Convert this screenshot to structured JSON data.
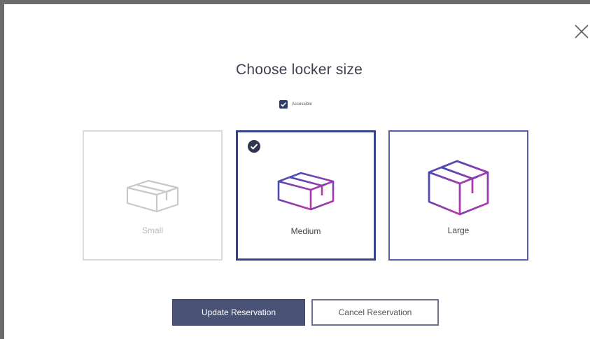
{
  "dialog": {
    "title": "Choose locker size",
    "close_icon": "close-icon"
  },
  "accessible": {
    "label": "Accessible",
    "checked": true
  },
  "sizes": [
    {
      "label": "Small",
      "state": "disabled"
    },
    {
      "label": "Medium",
      "state": "selected"
    },
    {
      "label": "Large",
      "state": "available"
    }
  ],
  "actions": {
    "update_label": "Update Reservation",
    "cancel_label": "Cancel Reservation"
  },
  "colors": {
    "primary": "#4a5275",
    "selected_border": "#36428a",
    "disabled": "#dcdcdc",
    "gradient_start": "#3a4bb5",
    "gradient_end": "#c236a8"
  }
}
